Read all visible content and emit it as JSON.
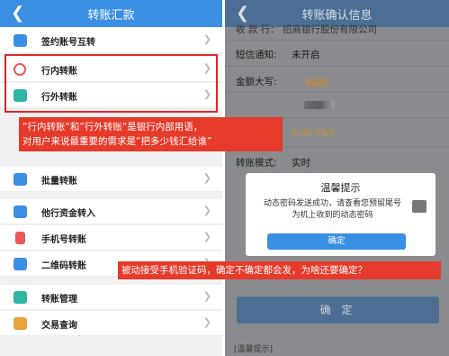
{
  "left_screen": {
    "title": "转账汇款",
    "back_icon": "chevron-left-icon",
    "items": [
      {
        "label": "签约账号互转",
        "icon": "card-icon",
        "color": "#3b8fe2"
      },
      {
        "label": "行内转账",
        "icon": "bank-transfer-icon",
        "color": "#e85a5a"
      },
      {
        "label": "行外转账",
        "icon": "interbank-transfer-icon",
        "color": "#2fb6a3"
      },
      {
        "label": "批量转账",
        "icon": "batch-icon",
        "color": "#3b8fe2"
      },
      {
        "label": "他行资金转入",
        "icon": "fund-in-icon",
        "color": "#3b8fe2"
      },
      {
        "label": "手机号转账",
        "icon": "phone-icon",
        "color": "#e85a5a"
      },
      {
        "label": "二维码转账",
        "icon": "qrcode-icon",
        "color": "#3b8fe2"
      },
      {
        "label": "转账管理",
        "icon": "manage-icon",
        "color": "#2fb6a3"
      },
      {
        "label": "交易查询",
        "icon": "query-icon",
        "color": "#e8a33b"
      }
    ]
  },
  "right_screen": {
    "title": "转账确认信息",
    "back_icon": "chevron-left-icon",
    "partial_top": "收 款 行：  招商银行股份有限公司",
    "rows": [
      {
        "key": "短信通知:",
        "value": "未开启"
      },
      {
        "key": "金额大写:",
        "value": ""
      },
      {
        "key": "",
        "value": "0.00 CNY"
      },
      {
        "key": "转账模式:",
        "value": "实时"
      }
    ],
    "dialog": {
      "title": "温馨提示",
      "message": "动态密码发送成功，请查看您预留尾号为机上收到的动态密码",
      "button": "确定"
    },
    "confirm_button": "确 定",
    "bottom_hint": "[温馨提示]"
  },
  "annotations": {
    "anno1_line1": "“行内转账“和”行外转账“是银行内部用语，",
    "anno1_line2": "对用户来说最重要的需求是“把多少钱汇给谁”",
    "anno2": "被动接受手机验证码，确定不确定都会发，为啥还要确定？"
  },
  "colors": {
    "primary": "#3b8fe2",
    "annotation": "#e63a2a",
    "highlight_border": "#d9272a"
  }
}
